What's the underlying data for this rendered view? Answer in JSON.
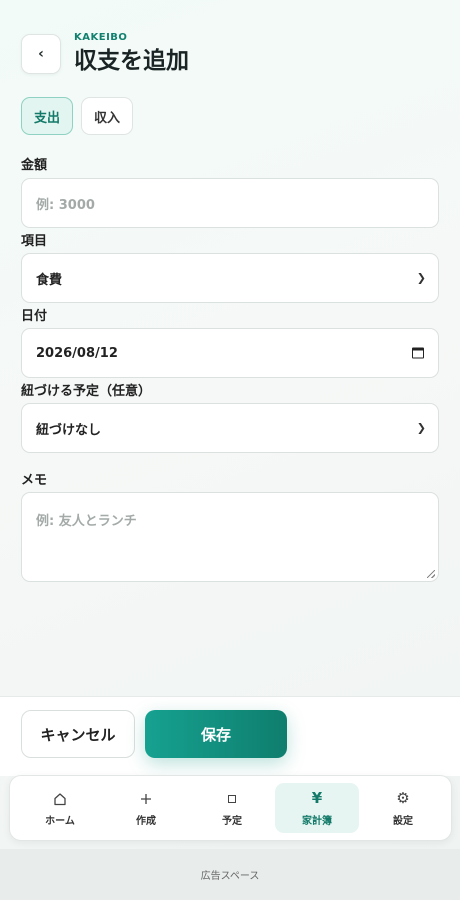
{
  "header": {
    "brand": "KAKEIBO",
    "title": "収支を追加",
    "back_symbol": "‹"
  },
  "type_toggle": {
    "options": [
      {
        "label": "支出",
        "active": true
      },
      {
        "label": "収入",
        "active": false
      }
    ]
  },
  "form": {
    "amount": {
      "label": "金額",
      "value": "",
      "placeholder": "例: 3000"
    },
    "category": {
      "label": "項目",
      "selected": "食費"
    },
    "date": {
      "label": "日付",
      "value": "2026/08/12"
    },
    "linked_plan": {
      "label": "紐づける予定（任意）",
      "selected": "紐づけなし"
    },
    "memo": {
      "label": "メモ",
      "value": "",
      "placeholder": "例: 友人とランチ"
    }
  },
  "actions": {
    "cancel_label": "キャンセル",
    "save_label": "保存"
  },
  "bottom_nav": {
    "items": [
      {
        "label": "ホーム",
        "icon": "home-icon",
        "active": false
      },
      {
        "label": "作成",
        "icon": "plus-icon",
        "active": false
      },
      {
        "label": "予定",
        "icon": "calendar-square-icon",
        "active": false
      },
      {
        "label": "家計簿",
        "icon": "yen-icon",
        "active": true
      },
      {
        "label": "設定",
        "icon": "gear-icon",
        "active": false
      }
    ]
  },
  "ad": {
    "label": "広告スペース"
  },
  "colors": {
    "accent": "#12806f",
    "accent_light": "#e3f5f0",
    "save_gradient_start": "#16a190",
    "save_gradient_end": "#0f7e6e"
  }
}
